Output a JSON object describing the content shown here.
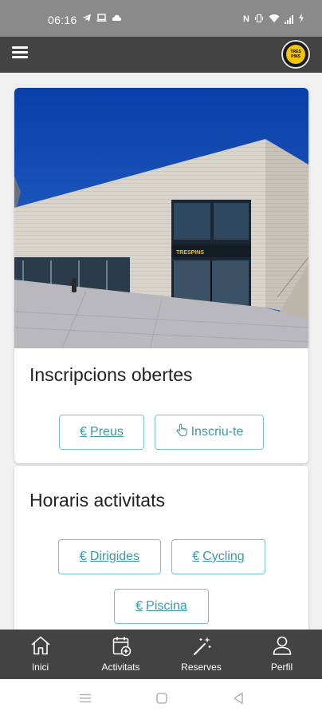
{
  "status_bar": {
    "time": "06:16",
    "icons": [
      "telegram-icon",
      "laptop-icon",
      "cloud-icon",
      "nfc-icon",
      "vibrate-icon",
      "wifi-icon",
      "signal-icon",
      "battery-charging-icon"
    ]
  },
  "app_bar": {
    "menu_icon": "hamburger-menu-icon",
    "logo_text_top": "TRES",
    "logo_text_bottom": "PINS"
  },
  "hero": {
    "sign_text": "TRESPINS"
  },
  "sections": {
    "inscripcions": {
      "title": "Inscripcions obertes",
      "preus_icon": "€",
      "preus_label": "Preus",
      "inscriu_icon": "hand-pointer-icon",
      "inscriu_label": "Inscriu-te"
    },
    "horaris": {
      "title": "Horaris activitats",
      "dirigides_icon": "€",
      "dirigides_label": "Dirigides",
      "cycling_icon": "€",
      "cycling_label": "Cycling",
      "piscina_icon": "€",
      "piscina_label": "Piscina"
    }
  },
  "bottom_nav": {
    "items": [
      {
        "label": "Inici",
        "icon": "home-icon"
      },
      {
        "label": "Activitats",
        "icon": "calendar-add-icon"
      },
      {
        "label": "Reserves",
        "icon": "magic-wand-icon"
      },
      {
        "label": "Perfil",
        "icon": "user-icon"
      }
    ]
  },
  "colors": {
    "app_bar": "#434343",
    "accent": "#3c9aa8",
    "button_border": "#7dc0c8",
    "status_bar": "#8a8a8a"
  }
}
